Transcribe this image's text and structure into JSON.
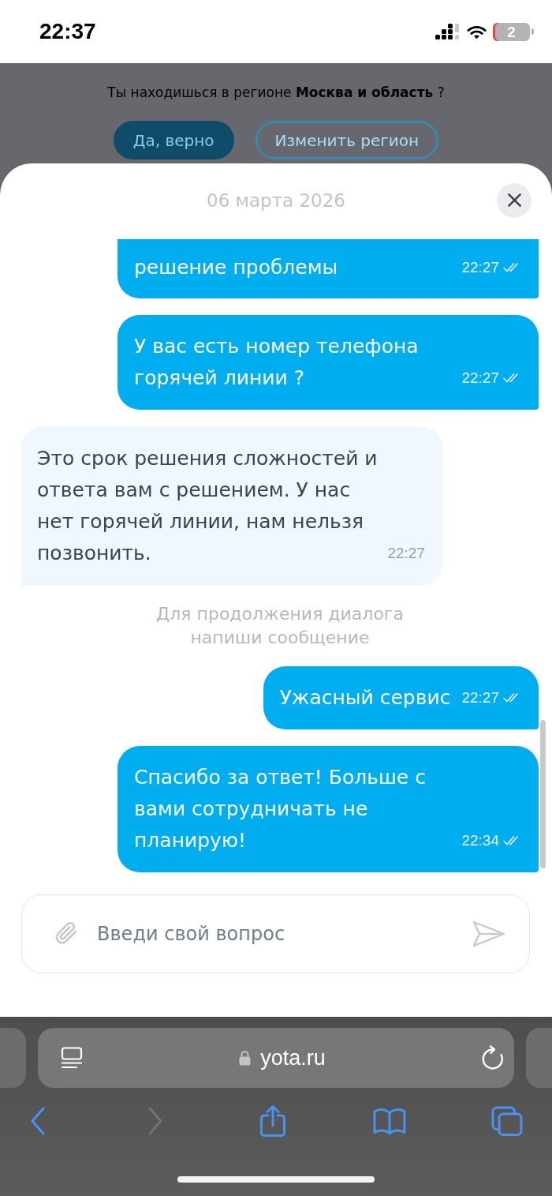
{
  "status_bar": {
    "time": "22:37",
    "battery": "2"
  },
  "backdrop": {
    "prompt": "Ты находишься в регионе **Москва и область** ?",
    "buttons": [
      {
        "label": "Да, верно",
        "primary": true
      },
      {
        "label": "Изменить регион",
        "primary": false
      }
    ]
  },
  "chat": {
    "date": "06 марта 2026",
    "messages": [
      {
        "kind": "outgoing",
        "text": "решение проблемы",
        "time": "22:27",
        "read": true,
        "cut_off": true
      },
      {
        "kind": "outgoing",
        "text": "У вас есть номер телефона горячей линии ?",
        "time": "22:27",
        "read": true
      },
      {
        "kind": "incoming",
        "text": "Это срок решения сложностей и ответа вам с решением. У нас нет горячей линии, нам нельзя позвонить.",
        "time": "22:27"
      },
      {
        "kind": "notice",
        "text": "Для продолжения диалога напиши сообщение"
      },
      {
        "kind": "outgoing",
        "text": "Ужасный сервис",
        "time": "22:27",
        "read": true
      },
      {
        "kind": "outgoing",
        "text": "Спасибо за ответ! Больше с вами сотрудничать не планирую!",
        "time": "22:34",
        "read": true
      }
    ],
    "input": {
      "placeholder": "Введи свой вопрос"
    }
  },
  "browser": {
    "url": "yota.ru",
    "toolbar": [
      {
        "kind": "back",
        "disabled": false
      },
      {
        "kind": "forward",
        "disabled": true
      },
      {
        "kind": "share",
        "disabled": false
      },
      {
        "kind": "bookmarks",
        "disabled": false
      },
      {
        "kind": "tabs",
        "disabled": false
      }
    ]
  }
}
